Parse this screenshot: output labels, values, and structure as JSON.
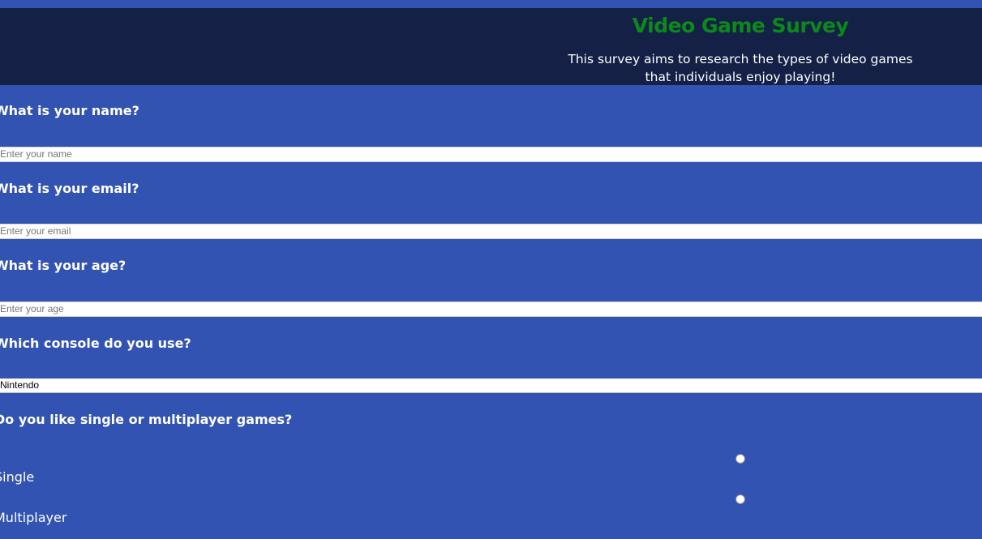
{
  "header": {
    "title": "Video Game Survey",
    "description": "This survey aims to research the types of video games that individuals enjoy playing!"
  },
  "questions": {
    "name": {
      "label": "What is your name?",
      "placeholder": "Enter your name"
    },
    "email": {
      "label": "What is your email?",
      "placeholder": "Enter your email"
    },
    "age": {
      "label": "What is your age?",
      "placeholder": "Enter your age"
    },
    "console": {
      "label": "Which console do you use?",
      "selected": "Nintendo"
    },
    "mode": {
      "label": "Do you like single or multiplayer games?",
      "options": [
        {
          "label": "Single",
          "checked": false
        },
        {
          "label": "Multiplayer",
          "checked": false
        }
      ]
    }
  },
  "colors": {
    "background": "#3253b1",
    "header": "#142046",
    "title": "#0a8a1a",
    "text": "#ffffff"
  }
}
